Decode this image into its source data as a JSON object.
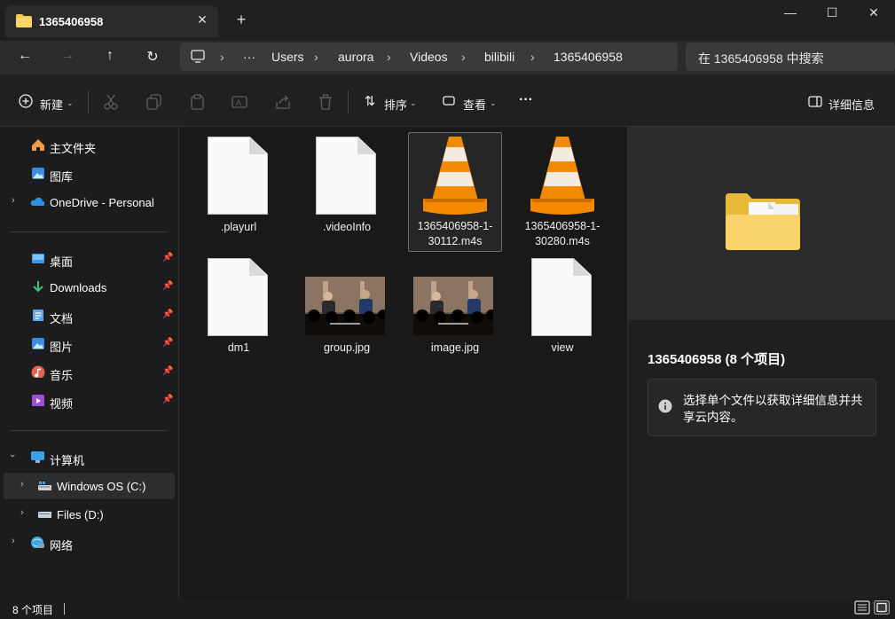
{
  "window": {
    "tab_title": "1365406958",
    "tab_close": "✕",
    "new_tab": "+",
    "minimize": "—",
    "maximize": "☐",
    "close": "✕"
  },
  "nav": {
    "back": "←",
    "forward": "→",
    "up": "↑",
    "refresh": "↻",
    "breadcrumb": [
      "Users",
      "aurora",
      "Videos",
      "bilibili",
      "1365406958"
    ],
    "ellipsis": "···",
    "search_placeholder": "在 1365406958 中搜索"
  },
  "toolbar": {
    "new_label": "新建",
    "sort_label": "排序",
    "view_label": "查看",
    "more": "···",
    "details_label": "详细信息"
  },
  "sidebar": {
    "quick": [
      {
        "label": "主文件夹",
        "icon": "home-icon"
      },
      {
        "label": "图库",
        "icon": "gallery-icon"
      },
      {
        "label": "OneDrive - Personal",
        "icon": "cloud-icon"
      }
    ],
    "pinned": [
      {
        "label": "桌面",
        "icon": "desktop-icon"
      },
      {
        "label": "Downloads",
        "icon": "download-icon"
      },
      {
        "label": "文档",
        "icon": "documents-icon"
      },
      {
        "label": "图片",
        "icon": "pictures-icon"
      },
      {
        "label": "音乐",
        "icon": "music-icon"
      },
      {
        "label": "视频",
        "icon": "videos-icon"
      }
    ],
    "computer": {
      "label": "计算机",
      "icon": "computer-icon"
    },
    "drives": [
      {
        "label": "Windows OS (C:)",
        "icon": "drive-c-icon"
      },
      {
        "label": "Files (D:)",
        "icon": "drive-d-icon"
      }
    ],
    "network": {
      "label": "网络",
      "icon": "network-icon"
    }
  },
  "files": [
    {
      "name": ".playurl",
      "kind": "document"
    },
    {
      "name": ".videoInfo",
      "kind": "document"
    },
    {
      "name": "1365406958-1-30112.m4s",
      "kind": "vlc"
    },
    {
      "name": "1365406958-1-30280.m4s",
      "kind": "vlc"
    },
    {
      "name": "dm1",
      "kind": "document"
    },
    {
      "name": "group.jpg",
      "kind": "image"
    },
    {
      "name": "image.jpg",
      "kind": "image"
    },
    {
      "name": "view",
      "kind": "document"
    }
  ],
  "files_display": {
    "f2_line1": "1365406958-1-",
    "f2_line2": "30112.m4s",
    "f3_line1": "1365406958-1-",
    "f3_line2": "30280.m4s"
  },
  "details": {
    "title": "1365406958 (8 个项目)",
    "info_icon": "i",
    "info_text": "选择单个文件以获取详细信息并共享云内容。"
  },
  "status": {
    "count": "8 个项目"
  },
  "colors": {
    "background": "#1c1c1c",
    "folder_yellow": "#f5c84a",
    "vlc_orange": "#f08a00",
    "accent": "#4aa0e6"
  }
}
